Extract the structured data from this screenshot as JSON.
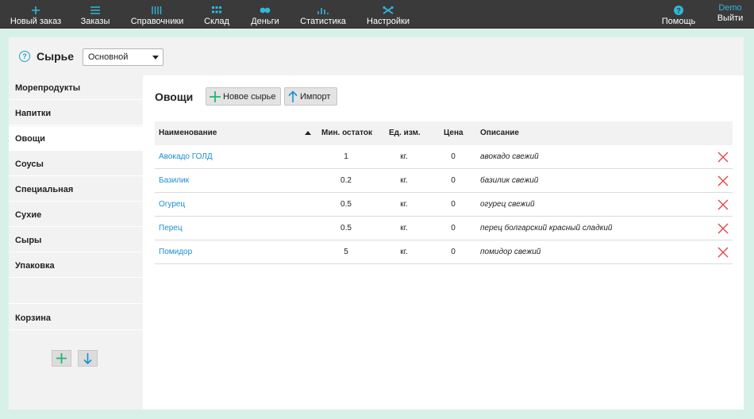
{
  "nav": {
    "left": [
      {
        "label": "Новый заказ",
        "icon": "plus-icon"
      },
      {
        "label": "Заказы",
        "icon": "menu-lines-icon"
      },
      {
        "label": "Справочники",
        "icon": "book-bars-icon"
      },
      {
        "label": "Склад",
        "icon": "grid-icon"
      },
      {
        "label": "Деньги",
        "icon": "coins-icon"
      },
      {
        "label": "Статистика",
        "icon": "bar-chart-icon"
      },
      {
        "label": "Настройки",
        "icon": "tools-icon"
      }
    ],
    "help": {
      "label": "Помощь",
      "icon": "help-circle-icon"
    },
    "user": {
      "name": "Demo",
      "logout": "Выйти"
    }
  },
  "header": {
    "title": "Сырье",
    "select_value": "Основной"
  },
  "sidebar": {
    "items": [
      "Морепродукты",
      "Напитки",
      "Овощи",
      "Соусы",
      "Специальная",
      "Сухие",
      "Сыры",
      "Упаковка",
      "",
      "Корзина"
    ],
    "active": "Овощи"
  },
  "main": {
    "title": "Овощи",
    "new_button": "Новое сырье",
    "import_button": "Импорт"
  },
  "table": {
    "headers": [
      "Наименование",
      "Мин. остаток",
      "Ед. изм.",
      "Цена",
      "Описание"
    ],
    "rows": [
      {
        "name": "Авокадо ГОЛД",
        "min": "1",
        "unit": "кг.",
        "price": "0",
        "desc": "авокадо свежий"
      },
      {
        "name": "Базилик",
        "min": "0.2",
        "unit": "кг.",
        "price": "0",
        "desc": "базилик свежий"
      },
      {
        "name": "Огурец",
        "min": "0.5",
        "unit": "кг.",
        "price": "0",
        "desc": "огурец свежий"
      },
      {
        "name": "Перец",
        "min": "0.5",
        "unit": "кг.",
        "price": "0",
        "desc": "перец болгарский красный сладкий"
      },
      {
        "name": "Помидор",
        "min": "5",
        "unit": "кг.",
        "price": "0",
        "desc": "помидор свежий"
      }
    ]
  },
  "colors": {
    "accent": "#2fb8d8",
    "link": "#1b8fd0",
    "delete": "#e0474c",
    "add": "#22b573",
    "background": "#d7f1e8",
    "topbar": "#3a3a3a"
  }
}
